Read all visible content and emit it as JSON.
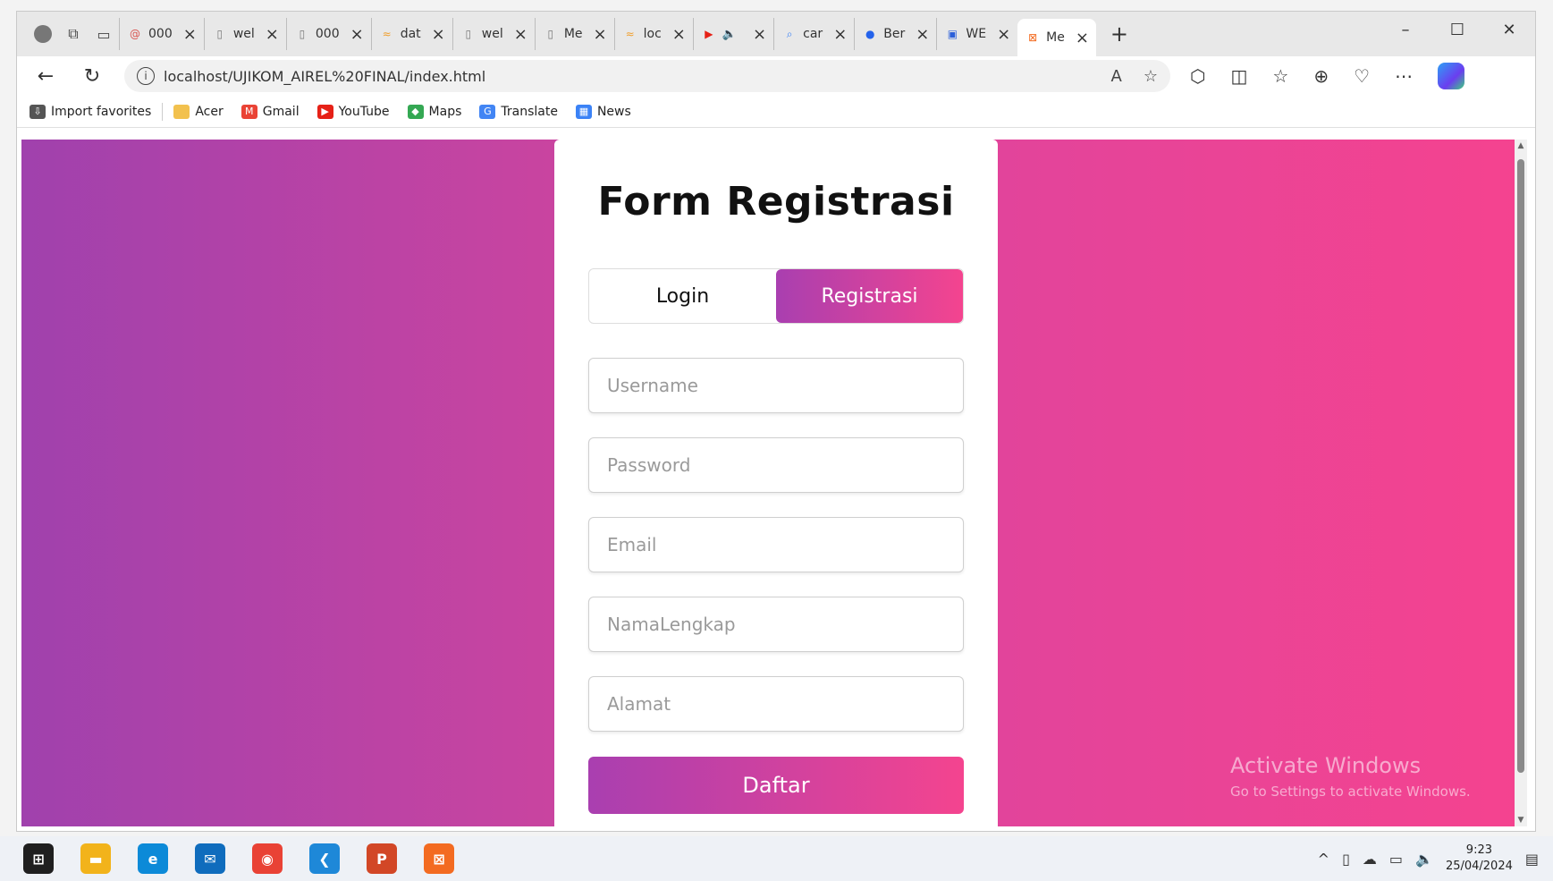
{
  "browser": {
    "tabs": [
      {
        "label": "000",
        "icon": "swirl-icon",
        "color": "#d9534f"
      },
      {
        "label": "wel",
        "icon": "page-icon",
        "color": "#777777"
      },
      {
        "label": "000",
        "icon": "page-icon",
        "color": "#777777"
      },
      {
        "label": "dat",
        "icon": "phpmyadmin-icon",
        "color": "#f0a030"
      },
      {
        "label": "wel",
        "icon": "page-icon",
        "color": "#777777"
      },
      {
        "label": "Me",
        "icon": "page-icon",
        "color": "#777777"
      },
      {
        "label": "loc",
        "icon": "phpmyadmin-icon",
        "color": "#f0a030"
      },
      {
        "label": "",
        "icon": "youtube-icon",
        "color": "#e62117",
        "audio": true
      },
      {
        "label": "car",
        "icon": "search-icon",
        "color": "#3b82f6"
      },
      {
        "label": "Ber",
        "icon": "blue-circle-icon",
        "color": "#2563eb"
      },
      {
        "label": "WE",
        "icon": "printer-icon",
        "color": "#2b5fd9"
      },
      {
        "label": "Me",
        "icon": "xampp-icon",
        "color": "#f36b21",
        "active": true
      }
    ],
    "url": "localhost/UJIKOM_AIREL%20FINAL/index.html",
    "favorites": [
      {
        "label": "Import favorites",
        "icon": "import-icon",
        "color": "#555555"
      },
      {
        "label": "Acer",
        "icon": "folder-icon",
        "color": "#f2c14e"
      },
      {
        "label": "Gmail",
        "icon": "gmail-icon",
        "color": "#ea4335"
      },
      {
        "label": "YouTube",
        "icon": "youtube-icon",
        "color": "#e62117"
      },
      {
        "label": "Maps",
        "icon": "maps-icon",
        "color": "#34a853"
      },
      {
        "label": "Translate",
        "icon": "translate-icon",
        "color": "#4285f4"
      },
      {
        "label": "News",
        "icon": "news-icon",
        "color": "#3b82f6"
      }
    ]
  },
  "form": {
    "title": "Form Registrasi",
    "tab_login": "Login",
    "tab_register": "Registrasi",
    "fields": [
      {
        "name": "username",
        "placeholder": "Username"
      },
      {
        "name": "password",
        "placeholder": "Password"
      },
      {
        "name": "email",
        "placeholder": "Email"
      },
      {
        "name": "nama_lengkap",
        "placeholder": "NamaLengkap"
      },
      {
        "name": "alamat",
        "placeholder": "Alamat"
      }
    ],
    "submit_label": "Daftar",
    "accent_start": "#a93fb0",
    "accent_end": "#f4448f"
  },
  "watermark": {
    "line1": "Activate Windows",
    "line2": "Go to Settings to activate Windows."
  },
  "taskbar": {
    "apps": [
      {
        "icon": "windows-start-icon",
        "color": "#1f1f1f"
      },
      {
        "icon": "file-explorer-icon",
        "color": "#f2b31b"
      },
      {
        "icon": "edge-icon",
        "color": "#0c8ad8"
      },
      {
        "icon": "mail-icon",
        "color": "#0f6cbd"
      },
      {
        "icon": "chrome-icon",
        "color": "#e94235"
      },
      {
        "icon": "vscode-icon",
        "color": "#1e88d8"
      },
      {
        "icon": "powerpoint-icon",
        "color": "#d24726"
      },
      {
        "icon": "xampp-icon",
        "color": "#f36b21"
      }
    ],
    "time": "9:23",
    "date": "25/04/2024"
  }
}
